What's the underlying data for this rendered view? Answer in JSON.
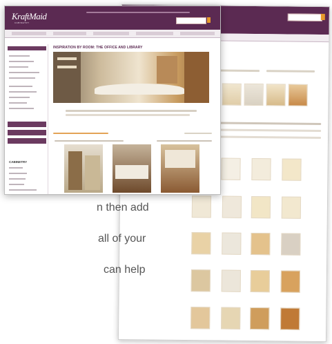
{
  "front_page": {
    "logo": "KraftMaid",
    "logo_sub": "CABINETRY",
    "title": "INSPIRATION BY ROOM: THE OFFICE AND LIBRARY",
    "sidebar_brand": "CABINETRY"
  },
  "paragraph": [
    "n then add",
    "all of your",
    "can help"
  ]
}
